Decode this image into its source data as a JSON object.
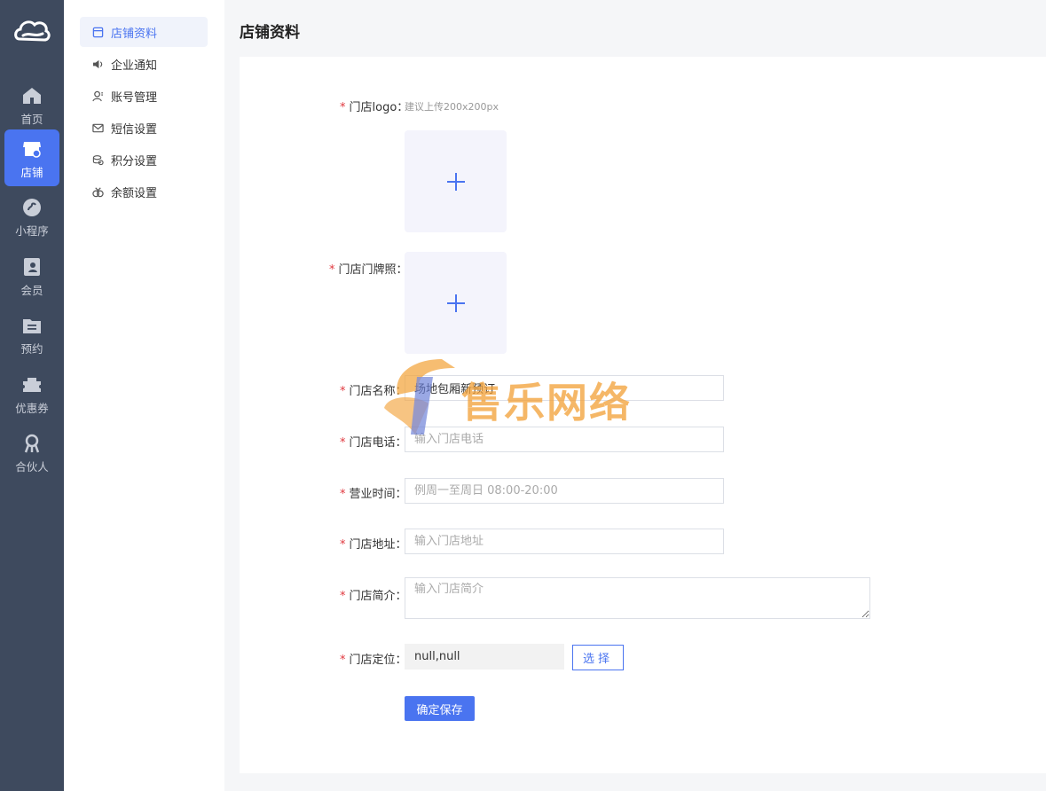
{
  "rail": {
    "items": [
      {
        "label": "首页",
        "icon": "home-icon"
      },
      {
        "label": "店铺",
        "icon": "store-icon",
        "active": true
      },
      {
        "label": "小程序",
        "icon": "miniprogram-icon"
      },
      {
        "label": "会员",
        "icon": "member-icon"
      },
      {
        "label": "预约",
        "icon": "booking-icon"
      },
      {
        "label": "优惠券",
        "icon": "coupon-icon"
      },
      {
        "label": "合伙人",
        "icon": "partner-icon"
      }
    ]
  },
  "submenu": {
    "items": [
      {
        "label": "店铺资料",
        "icon": "store-info-icon",
        "active": true
      },
      {
        "label": "企业通知",
        "icon": "speaker-icon"
      },
      {
        "label": "账号管理",
        "icon": "account-icon"
      },
      {
        "label": "短信设置",
        "icon": "mail-icon"
      },
      {
        "label": "积分设置",
        "icon": "points-icon"
      },
      {
        "label": "余额设置",
        "icon": "balance-icon"
      }
    ]
  },
  "page": {
    "title": "店铺资料"
  },
  "form": {
    "logo": {
      "label": "门店logo：",
      "hint": "建议上传200x200px"
    },
    "license": {
      "label": "门店门牌照："
    },
    "name": {
      "label": "门店名称：",
      "value": "场地包厢新预订"
    },
    "phone": {
      "label": "门店电话：",
      "placeholder": "输入门店电话"
    },
    "hours": {
      "label": "营业时间：",
      "placeholder": "例周一至周日 08:00-20:00"
    },
    "address": {
      "label": "门店地址：",
      "placeholder": "输入门店地址"
    },
    "intro": {
      "label": "门店简介：",
      "placeholder": "输入门店简介"
    },
    "location": {
      "label": "门店定位：",
      "value": "null,null",
      "select_label": "选择"
    },
    "save_label": "确定保存"
  },
  "watermark": {
    "text": "售乐网络"
  },
  "colors": {
    "accent": "#4a74f0",
    "rail_bg": "#3e4a5e",
    "required": "#e0383e"
  }
}
